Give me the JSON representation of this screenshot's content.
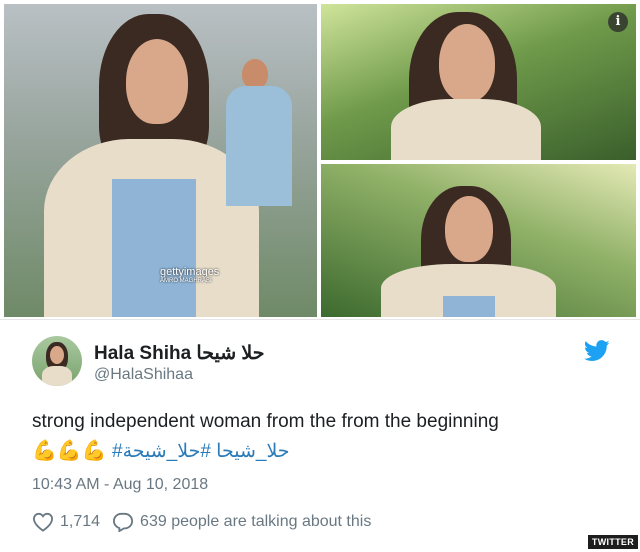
{
  "media": {
    "watermark_brand": "gettyimages",
    "watermark_credit": "AMRO MAGHRABI"
  },
  "tweet": {
    "display_name": "Hala Shiha حلا شيحا",
    "handle": "@HalaShihaa",
    "text": "strong independent woman from the from the beginning",
    "emojis": "💪💪💪",
    "hashtags": "#حلا_شيحا #حلا_شيحة",
    "timestamp": "10:43 AM - Aug 10, 2018",
    "likes": "1,714",
    "conversation": "639 people are talking about this"
  },
  "source_badge": "TWITTER",
  "colors": {
    "twitter_blue": "#1da1f2",
    "hashtag_blue": "#2b7bb9",
    "muted_gray": "#697882"
  },
  "icons": [
    "info-icon",
    "twitter-bird-icon",
    "heart-icon",
    "reply-icon"
  ]
}
